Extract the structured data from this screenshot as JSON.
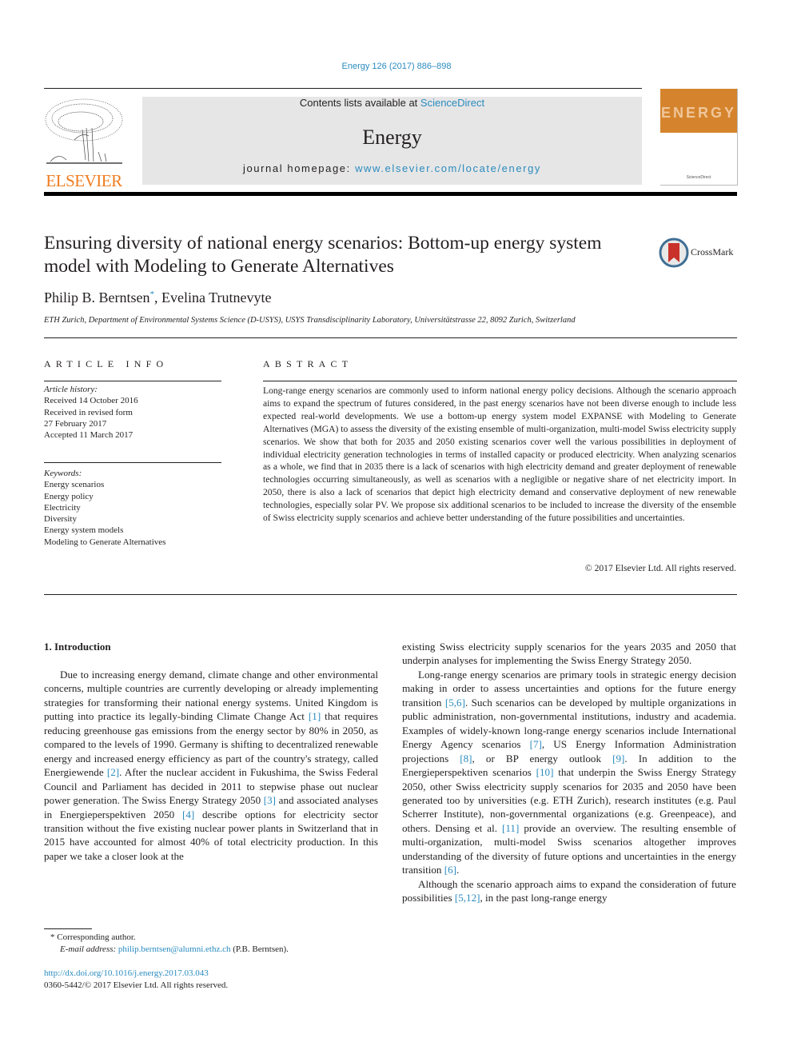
{
  "journal_header": {
    "citation": "Energy 126 (2017) 886–898",
    "contents_prefix": "Contents lists available at ",
    "contents_link": "ScienceDirect",
    "journal_title": "Energy",
    "homepage_prefix": "journal homepage: ",
    "homepage_link": "www.elsevier.com/locate/energy",
    "publisher_logo_text": "ELSEVIER",
    "cover_word": "ENERGY",
    "cover_footer": "ScienceDirect"
  },
  "article": {
    "title": "Ensuring diversity of national energy scenarios: Bottom-up energy system model with Modeling to Generate Alternatives",
    "crossmark_label": "CrossMark",
    "authors": [
      {
        "name": "Philip B. Berntsen",
        "mark": "*"
      },
      {
        "name": "Evelina Trutnevyte",
        "mark": ""
      }
    ],
    "author_separator": ", ",
    "affiliation": "ETH Zurich, Department of Environmental Systems Science (D-USYS), USYS Transdisciplinarity Laboratory, Universitätstrasse 22, 8092 Zurich, Switzerland"
  },
  "article_info": {
    "heading": "ARTICLE INFO",
    "history_label": "Article history:",
    "history": [
      "Received 14 October 2016",
      "Received in revised form",
      "27 February 2017",
      "Accepted 11 March 2017"
    ],
    "keywords_label": "Keywords:",
    "keywords": [
      "Energy scenarios",
      "Energy policy",
      "Electricity",
      "Diversity",
      "Energy system models",
      "Modeling to Generate Alternatives"
    ]
  },
  "abstract": {
    "heading": "ABSTRACT",
    "text": "Long-range energy scenarios are commonly used to inform national energy policy decisions. Although the scenario approach aims to expand the spectrum of futures considered, in the past energy scenarios have not been diverse enough to include less expected real-world developments. We use a bottom-up energy system model EXPANSE with Modeling to Generate Alternatives (MGA) to assess the diversity of the existing ensemble of multi-organization, multi-model Swiss electricity supply scenarios. We show that both for 2035 and 2050 existing scenarios cover well the various possibilities in deployment of individual electricity generation technologies in terms of installed capacity or produced electricity. When analyzing scenarios as a whole, we find that in 2035 there is a lack of scenarios with high electricity demand and greater deployment of renewable technologies occurring simultaneously, as well as scenarios with a negligible or negative share of net electricity import. In 2050, there is also a lack of scenarios that depict high electricity demand and conservative deployment of new renewable technologies, especially solar PV. We propose six additional scenarios to be included to increase the diversity of the ensemble of Swiss electricity supply scenarios and achieve better understanding of the future possibilities and uncertainties.",
    "copyright": "© 2017 Elsevier Ltd. All rights reserved."
  },
  "body": {
    "section_heading": "1.  Introduction",
    "left_paragraphs": [
      [
        {
          "t": "Due to increasing energy demand, climate change and other environmental concerns, multiple countries are currently developing or already implementing strategies for transforming their national energy systems. United Kingdom is putting into practice its legally-binding Climate Change Act "
        },
        {
          "ref": "[1]"
        },
        {
          "t": " that requires reducing greenhouse gas emissions from the energy sector by 80% in 2050, as compared to the levels of 1990. Germany is shifting to decentralized renewable energy and increased energy efficiency as part of the country's strategy, called Energiewende "
        },
        {
          "ref": "[2]"
        },
        {
          "t": ". After the nuclear accident in Fukushima, the Swiss Federal Council and Parliament has decided in 2011 to stepwise phase out nuclear power generation. The Swiss Energy Strategy 2050 "
        },
        {
          "ref": "[3]"
        },
        {
          "t": " and associated analyses in Energieperspektiven 2050 "
        },
        {
          "ref": "[4]"
        },
        {
          "t": " describe options for electricity sector transition without the five existing nuclear power plants in Switzerland that in 2015 have accounted for almost 40% of total electricity production. In this paper we take a closer look at the"
        }
      ]
    ],
    "right_paragraphs": [
      [
        {
          "t": "existing Swiss electricity supply scenarios for the years 2035 and 2050 that underpin analyses for implementing the Swiss Energy Strategy 2050."
        }
      ],
      [
        {
          "t": "Long-range energy scenarios are primary tools in strategic energy decision making in order to assess uncertainties and options for the future energy transition "
        },
        {
          "ref": "[5,6]"
        },
        {
          "t": ". Such scenarios can be developed by multiple organizations in public administration, non-governmental institutions, industry and academia. Examples of widely-known long-range energy scenarios include International Energy Agency scenarios "
        },
        {
          "ref": "[7]"
        },
        {
          "t": ", US Energy Information Administration projections "
        },
        {
          "ref": "[8]"
        },
        {
          "t": ", or BP energy outlook "
        },
        {
          "ref": "[9]"
        },
        {
          "t": ". In addition to the Energieperspektiven scenarios "
        },
        {
          "ref": "[10]"
        },
        {
          "t": " that underpin the Swiss Energy Strategy 2050, other Swiss electricity supply scenarios for 2035 and 2050 have been generated too by universities (e.g. ETH Zurich), research institutes (e.g. Paul Scherrer Institute), non-governmental organizations (e.g. Greenpeace), and others. Densing et al. "
        },
        {
          "ref": "[11]"
        },
        {
          "t": " provide an overview. The resulting ensemble of multi-organization, multi-model Swiss scenarios altogether improves understanding of the diversity of future options and uncertainties in the energy transition "
        },
        {
          "ref": "[6]"
        },
        {
          "t": "."
        }
      ],
      [
        {
          "t": "Although the scenario approach aims to expand the consideration of future possibilities "
        },
        {
          "ref": "[5,12]"
        },
        {
          "t": ", in the past long-range energy"
        }
      ]
    ]
  },
  "footnotes": {
    "corresponding": "* Corresponding author.",
    "email_label": "E-mail address: ",
    "email": "philip.berntsen@alumni.ethz.ch",
    "email_suffix": " (P.B. Berntsen).",
    "doi": "http://dx.doi.org/10.1016/j.energy.2017.03.043",
    "issn_copyright": "0360-5442/© 2017 Elsevier Ltd. All rights reserved."
  },
  "colors": {
    "link": "#2a8bbf",
    "elsevier_orange": "#f07c1e",
    "cover_orange": "#d5842d",
    "banner_gray": "#e6e6e6"
  }
}
